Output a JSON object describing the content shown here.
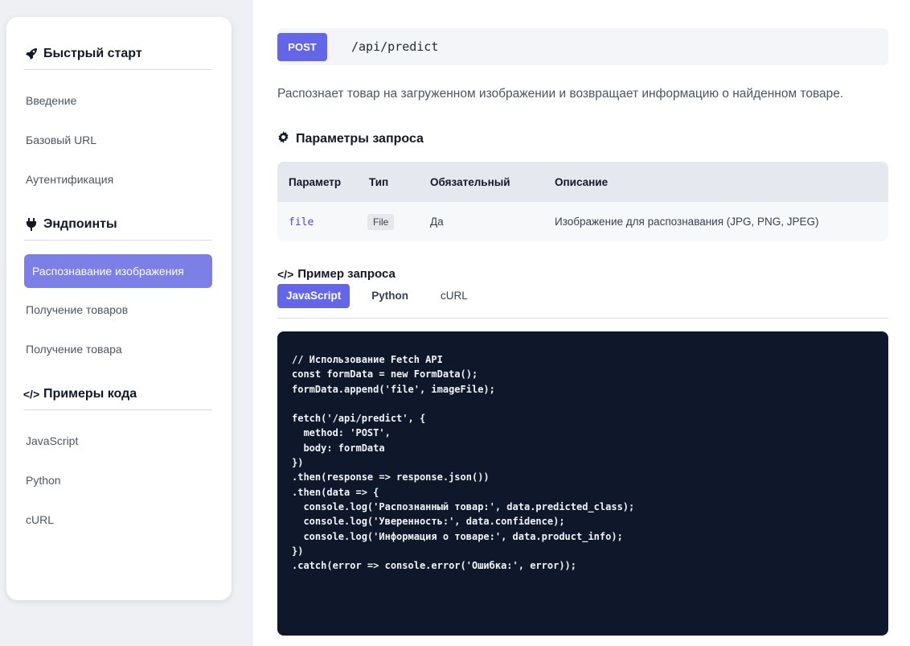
{
  "sidebar": {
    "sections": [
      {
        "icon": "rocket-icon",
        "title": "Быстрый старт",
        "items": [
          "Введение",
          "Базовый URL",
          "Аутентификация"
        ]
      },
      {
        "icon": "plug-icon",
        "title": "Эндпоинты",
        "items": [
          "Распознавание изображения",
          "Получение товаров",
          "Получение товара"
        ]
      },
      {
        "icon": "code-icon",
        "title": "Примеры кода",
        "items": [
          "JavaScript",
          "Python",
          "cURL"
        ]
      }
    ],
    "active_item": "Распознавание изображения"
  },
  "endpoint": {
    "method": "POST",
    "path": "/api/predict",
    "description": "Распознает товар на загруженном изображении и возвращает информацию о найденном товаре."
  },
  "params": {
    "title": "Параметры запроса",
    "headers": [
      "Параметр",
      "Тип",
      "Обязательный",
      "Описание"
    ],
    "rows": [
      {
        "name": "file",
        "type": "File",
        "required": "Да",
        "description": "Изображение для распознавания (JPG, PNG, JPEG)"
      }
    ]
  },
  "example": {
    "title": "Пример запроса",
    "tabs": [
      "JavaScript",
      "Python",
      "cURL"
    ],
    "active_tab": "JavaScript",
    "code": "// Использование Fetch API\nconst formData = new FormData();\nformData.append('file', imageFile);\n\nfetch('/api/predict', {\n  method: 'POST',\n  body: formData\n})\n.then(response => response.json())\n.then(data => {\n  console.log('Распознанный товар:', data.predicted_class);\n  console.log('Уверенность:', data.confidence);\n  console.log('Информация о товаре:', data.product_info);\n})\n.catch(error => console.error('Ошибка:', error));"
  },
  "colors": {
    "accent": "#6366e8",
    "active_nav": "#7b7fe6",
    "code_bg": "#0f172a"
  }
}
